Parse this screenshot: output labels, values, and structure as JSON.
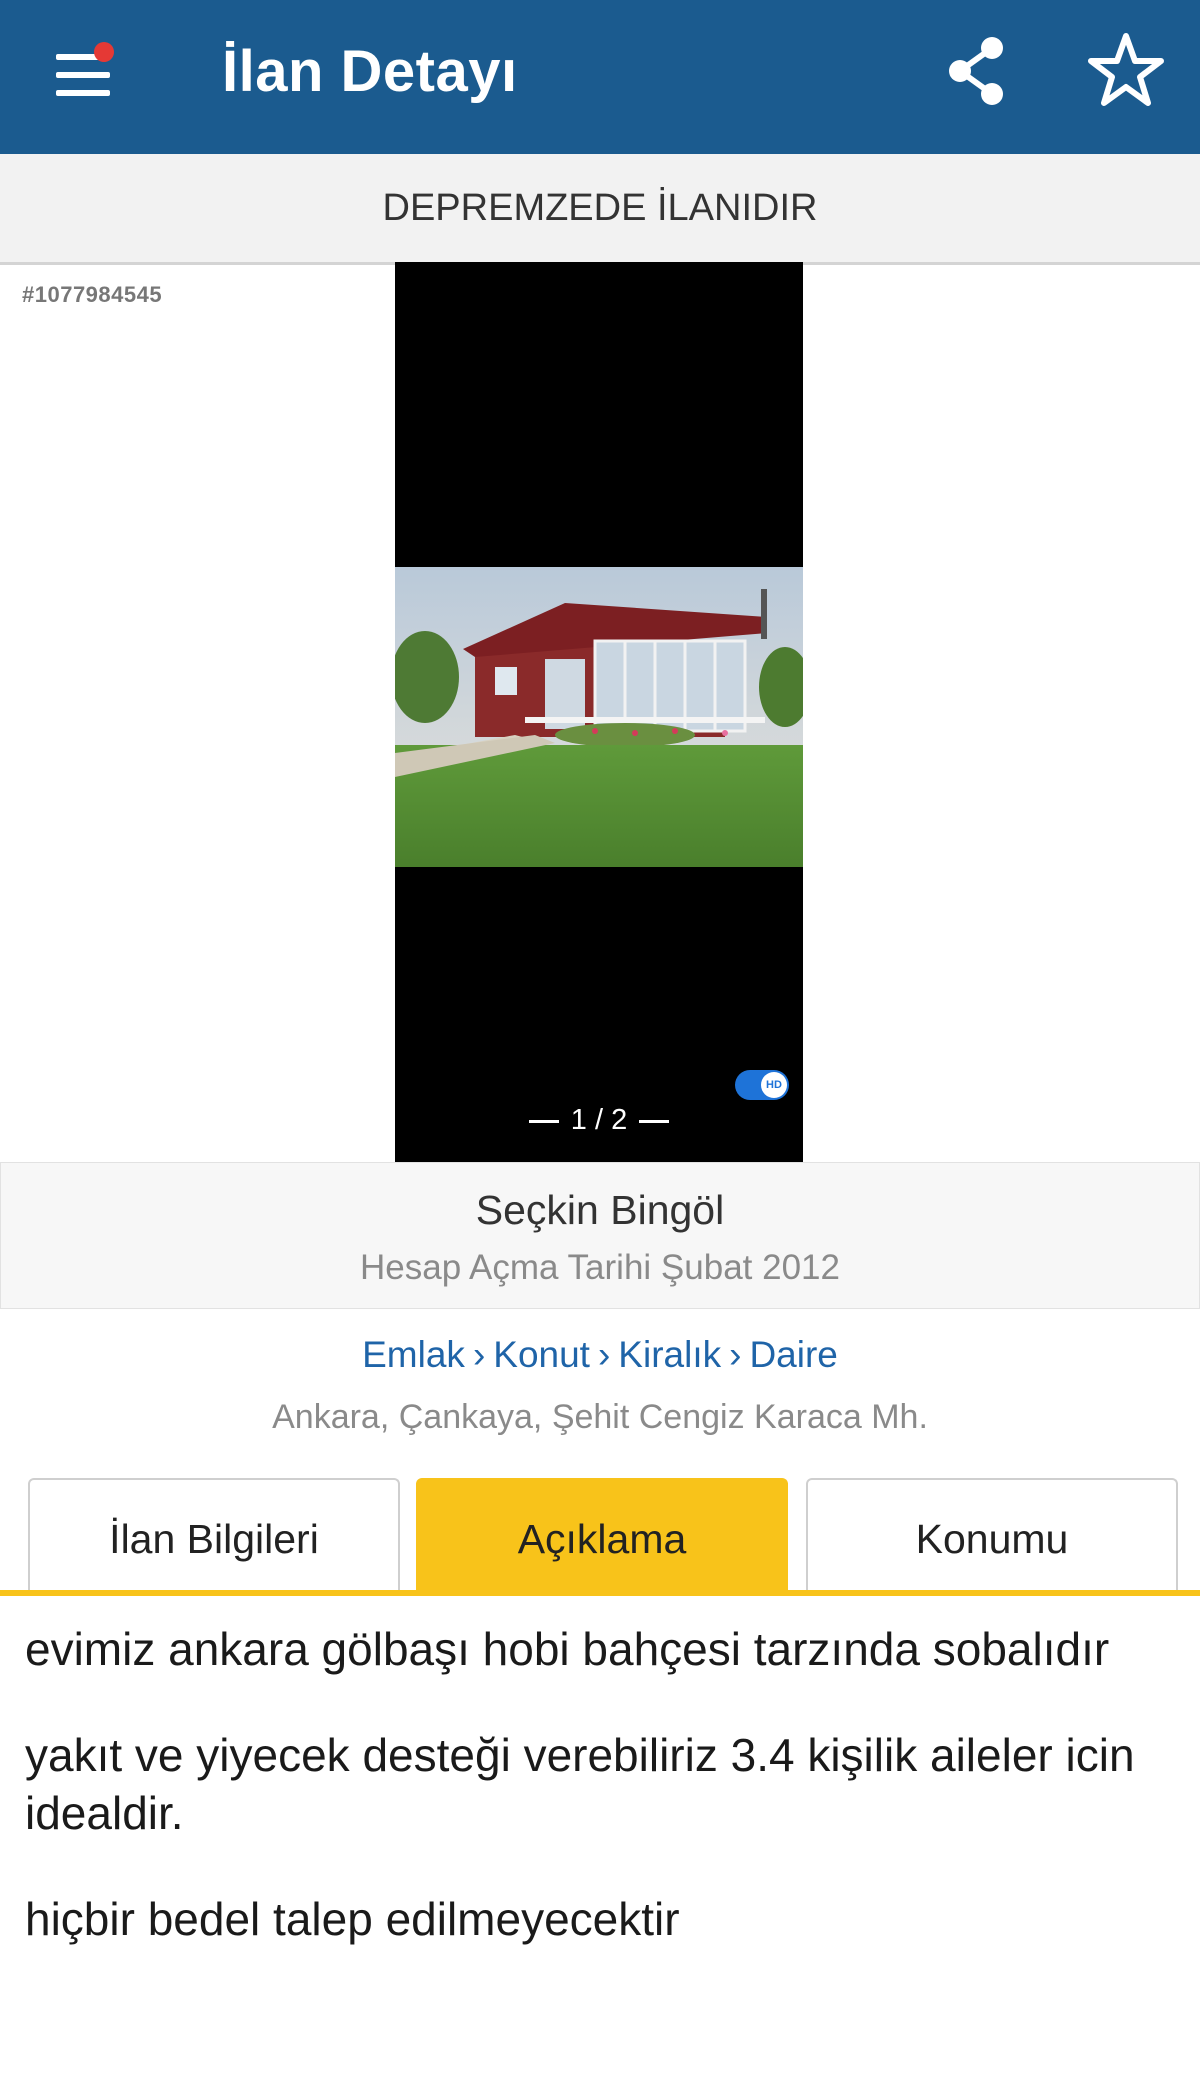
{
  "header": {
    "title": "İlan Detayı",
    "menu_icon": "hamburger-menu-icon",
    "notification_dot_color": "#e53935",
    "share_icon": "share-icon",
    "favorite_icon": "star-outline-icon",
    "background_color": "#1b5b8f"
  },
  "banner": {
    "text": "DEPREMZEDE İLANIDIR"
  },
  "listing": {
    "number": "#1077984545"
  },
  "gallery": {
    "pager": "1 / 2",
    "hd_label": "HD"
  },
  "seller": {
    "name": "Seçkin Bingöl",
    "since": "Hesap Açma Tarihi  Şubat 2012"
  },
  "breadcrumb": {
    "items": [
      "Emlak",
      "Konut",
      "Kiralık",
      "Daire"
    ],
    "separator": "›"
  },
  "location": "Ankara, Çankaya, Şehit Cengiz Karaca Mh.",
  "tabs": [
    {
      "label": "İlan Bilgileri",
      "active": false
    },
    {
      "label": "Açıklama",
      "active": true
    },
    {
      "label": "Konumu",
      "active": false
    }
  ],
  "accent_color": "#f8c31a",
  "description": {
    "paragraphs": [
      "evimiz ankara gölbaşı hobi bahçesi tarzında sobalıdır",
      "yakıt ve yiyecek desteği verebiliriz 3.4 kişilik aileler icin idealdir.",
      "hiçbir bedel talep edilmeyecektir"
    ]
  }
}
